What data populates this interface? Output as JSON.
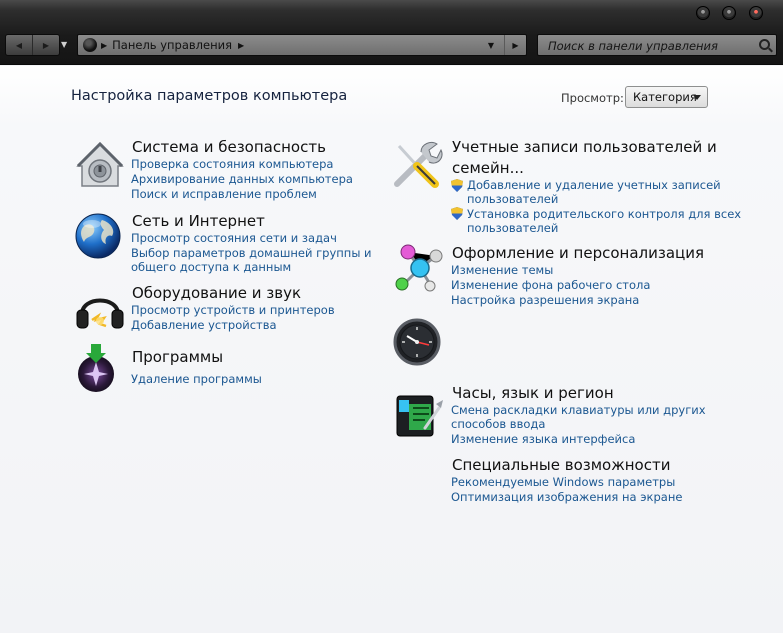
{
  "window": {
    "address": "Панель управления",
    "search_placeholder": "Поиск в панели управления"
  },
  "header": {
    "title": "Настройка параметров компьютера",
    "view_label": "Просмотр:",
    "view_value": "Категория"
  },
  "categories": [
    {
      "title": "Система и безопасность",
      "icon": "house-lock-icon",
      "links": [
        "Проверка состояния компьютера",
        "Архивирование данных компьютера",
        "Поиск и исправление проблем"
      ]
    },
    {
      "title": "Сеть и Интернет",
      "icon": "globe-icon",
      "links": [
        "Просмотр состояния сети и задач",
        "Выбор параметров домашней группы и",
        "общего доступа к данным"
      ]
    },
    {
      "title": "Оборудование и звук",
      "icon": "headphones-icon",
      "links": [
        "Просмотр устройств и принтеров",
        "Добавление устройства"
      ]
    },
    {
      "title": "Программы",
      "icon": "programs-icon",
      "links": [
        "Удаление программы"
      ]
    },
    {
      "title_line1": "Учетные записи пользователей и",
      "title_line2": "семейн...",
      "icon": "tools-icon",
      "links": [
        "Добавление и удаление учетных записей",
        "пользователей",
        "Установка родительского контроля для всех",
        "пользователей"
      ]
    },
    {
      "title": "Оформление и персонализация",
      "icon": "appearance-icon",
      "links": [
        "Изменение темы",
        "Изменение фона рабочего стола",
        "Настройка разрешения экрана"
      ]
    },
    {
      "title": "Часы, язык и регион",
      "icon": "clock-icon",
      "links": [
        "Смена раскладки клавиатуры или других",
        "способов ввода",
        "Изменение языка интерфейса"
      ]
    },
    {
      "title": "Специальные возможности",
      "icon": "accessibility-icon",
      "links": [
        "Рекомендуемые Windows параметры",
        "Оптимизация изображения на экране"
      ]
    }
  ]
}
